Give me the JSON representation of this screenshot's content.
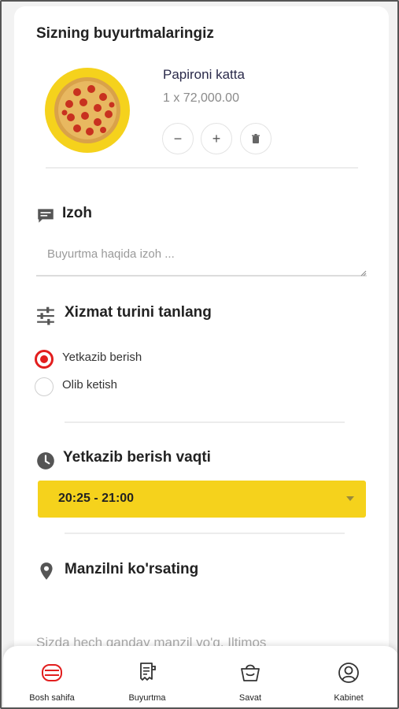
{
  "orders": {
    "title": "Sizning buyurtmalaringiz",
    "item": {
      "name": "Papironi katta",
      "price_line": "1 x 72,000.00",
      "image_icon": "pepperoni-pizza"
    },
    "controls": {
      "minus_label": "−",
      "plus_label": "+",
      "delete_icon": "trash-icon"
    }
  },
  "comment": {
    "title": "Izoh",
    "icon": "chat-icon",
    "placeholder": "Buyurtma haqida izoh ...",
    "value": ""
  },
  "service": {
    "title": "Xizmat turini tanlang",
    "icon": "sliders-icon",
    "options": [
      {
        "label": "Yetkazib berish",
        "selected": true
      },
      {
        "label": "Olib ketish",
        "selected": false
      }
    ]
  },
  "delivery_time": {
    "title": "Yetkazib berish vaqti",
    "icon": "clock-icon",
    "selected": "20:25 - 21:00"
  },
  "address": {
    "title": "Manzilni ko'rsating",
    "icon": "location-pin-icon",
    "note": "Sizda hech qanday manzil yo'q. Iltimos"
  },
  "nav": {
    "items": [
      {
        "label": "Bosh sahifa",
        "icon": "home-icon",
        "active": true
      },
      {
        "label": "Buyurtma",
        "icon": "receipt-icon",
        "active": false
      },
      {
        "label": "Savat",
        "icon": "basket-icon",
        "active": false
      },
      {
        "label": "Kabinet",
        "icon": "user-icon",
        "active": false
      }
    ]
  },
  "colors": {
    "accent_yellow": "#f5d21c",
    "accent_red": "#e21e1e",
    "text_dark": "#222222",
    "text_muted": "#8a8a8a"
  }
}
